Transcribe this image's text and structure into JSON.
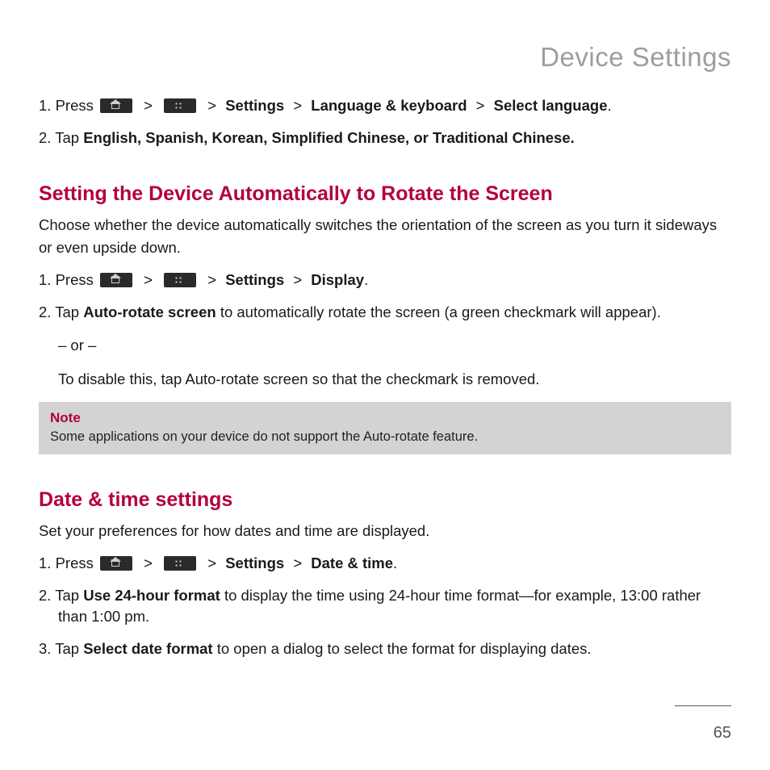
{
  "pageTitle": "Device Settings",
  "topSteps": {
    "s1_prefix": "1. Press ",
    "s1_crumbs": [
      "Settings",
      "Language & keyboard",
      "Select language"
    ],
    "s2_prefix": "2. Tap ",
    "s2_bold": "English, Spanish, Korean, Simplified Chinese, or Traditional Chinese."
  },
  "rotate": {
    "heading": "Setting the Device Automatically to Rotate the Screen",
    "intro": "Choose whether the device automatically switches the orientation of the screen as you turn it sideways or even upside down.",
    "s1_prefix": "1. Press ",
    "s1_crumbs": [
      "Settings",
      "Display"
    ],
    "s2_prefix": "2. Tap ",
    "s2_bold": "Auto-rotate screen",
    "s2_rest": " to automatically rotate the screen (a green checkmark will appear).",
    "or": "– or –",
    "disable_pre": "To disable this, tap ",
    "disable_bold": "Auto-rotate screen",
    "disable_post": " so that the checkmark is removed."
  },
  "note": {
    "title": "Note",
    "text": "Some applications on your device do not support the Auto-rotate feature."
  },
  "datetime": {
    "heading": "Date & time settings",
    "intro": "Set your preferences for how dates and time are displayed.",
    "s1_prefix": "1. Press ",
    "s1_crumbs": [
      "Settings",
      "Date & time"
    ],
    "s2_prefix": "2. Tap ",
    "s2_bold": "Use 24-hour format",
    "s2_rest": " to display the time using 24-hour time format—for example, 13:00 rather than 1:00 pm.",
    "s3_prefix": "3. Tap ",
    "s3_bold": "Select date format",
    "s3_rest": " to open a dialog to select the format for displaying dates."
  },
  "pageNumber": "65",
  "gt": ">"
}
